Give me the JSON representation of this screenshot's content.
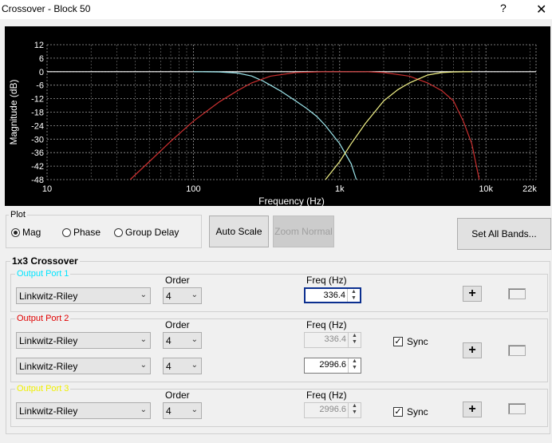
{
  "window": {
    "title": "Crossover - Block 50",
    "help": "?",
    "close": "✕"
  },
  "graph": {
    "ylabel": "Magnitude (dB)",
    "xlabel": "Frequency (Hz)",
    "yticks": [
      "12",
      "6",
      "0",
      "-6",
      "-12",
      "-18",
      "-24",
      "-30",
      "-36",
      "-42",
      "-48"
    ],
    "xticks": [
      "10",
      "100",
      "1k",
      "10k",
      "22k"
    ],
    "xtick_values": [
      10,
      100,
      1000,
      10000,
      22000
    ],
    "ytick_values": [
      12,
      6,
      0,
      -6,
      -12,
      -18,
      -24,
      -30,
      -36,
      -42,
      -48
    ]
  },
  "plot": {
    "label": "Plot",
    "options": [
      "Mag",
      "Phase",
      "Group Delay"
    ],
    "selected": "Mag"
  },
  "buttons": {
    "auto_scale": "Auto Scale",
    "zoom_normal": "Zoom Normal",
    "set_all_bands": "Set All Bands..."
  },
  "crossover_title": "1x3 Crossover",
  "column_headers": {
    "order": "Order",
    "freq": "Freq (Hz)"
  },
  "sync_label": "Sync",
  "ports": [
    {
      "name": "Output Port 1",
      "color": "#00e5ff",
      "rows": [
        {
          "filter": "Linkwitz-Riley",
          "order": "4",
          "freq": "336.4",
          "freq_state": "focused"
        }
      ]
    },
    {
      "name": "Output Port 2",
      "color": "#e00000",
      "rows": [
        {
          "filter": "Linkwitz-Riley",
          "order": "4",
          "freq": "336.4",
          "freq_state": "disabled"
        },
        {
          "filter": "Linkwitz-Riley",
          "order": "4",
          "freq": "2996.6",
          "freq_state": "enabled"
        }
      ],
      "sync": true
    },
    {
      "name": "Output Port 3",
      "color": "#f0f000",
      "rows": [
        {
          "filter": "Linkwitz-Riley",
          "order": "4",
          "freq": "2996.6",
          "freq_state": "disabled"
        }
      ],
      "sync": true
    }
  ],
  "chart_data": {
    "type": "line",
    "xscale": "log",
    "xlim": [
      10,
      22000
    ],
    "ylim": [
      -48,
      12
    ],
    "grid": true,
    "series": [
      {
        "color": "#9ee8ee",
        "x": [
          100,
          150,
          200,
          250,
          300,
          336.4,
          400,
          500,
          600,
          700,
          800,
          1000,
          1200,
          1300
        ],
        "y": [
          0,
          -0.1,
          -0.6,
          -1.9,
          -4.2,
          -6,
          -8.8,
          -13,
          -16.5,
          -20,
          -24,
          -32,
          -41,
          -48
        ]
      },
      {
        "color": "#cc3030",
        "x": [
          37,
          50,
          70,
          100,
          150,
          200,
          250,
          336.4,
          500,
          800,
          1500,
          2000,
          2996.6,
          4000,
          5000,
          6000,
          7000,
          8000,
          9000
        ],
        "y": [
          -48,
          -40,
          -31,
          -22,
          -13.5,
          -8.5,
          -5,
          -2,
          -0.4,
          0,
          0,
          -0.4,
          -2,
          -5,
          -8.5,
          -13,
          -22,
          -32,
          -48
        ]
      },
      {
        "color": "#f3f388",
        "x": [
          800,
          1000,
          1200,
          1500,
          2000,
          2500,
          2996.6,
          4000,
          5000,
          6000,
          8000
        ],
        "y": [
          -48,
          -40,
          -32,
          -23,
          -13,
          -8,
          -5,
          -1.5,
          -0.4,
          -0.1,
          0
        ]
      }
    ]
  }
}
